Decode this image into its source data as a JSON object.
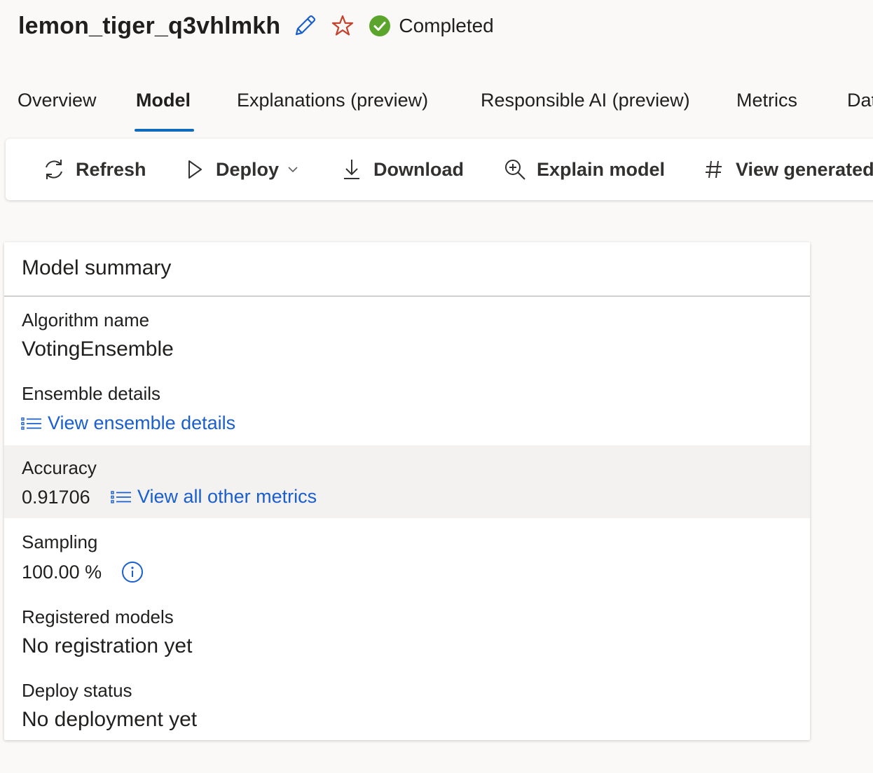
{
  "header": {
    "run_title": "lemon_tiger_q3vhlmkh",
    "status_text": "Completed",
    "icons": {
      "edit": "pencil-icon",
      "favorite": "star-outline-icon",
      "status": "check-circle-icon"
    },
    "colors": {
      "edit_icon": "#1a5fcd",
      "favorite_icon": "#c4422b",
      "status_icon": "#5ba52d"
    }
  },
  "tabs": [
    {
      "label": "Overview",
      "active": false
    },
    {
      "label": "Model",
      "active": true
    },
    {
      "label": "Explanations (preview)",
      "active": false
    },
    {
      "label": "Responsible AI (preview)",
      "active": false
    },
    {
      "label": "Metrics",
      "active": false
    },
    {
      "label": "Data transformation (preview)",
      "active": false
    }
  ],
  "toolbar": {
    "refresh_label": "Refresh",
    "deploy_label": "Deploy",
    "download_label": "Download",
    "explain_label": "Explain model",
    "view_generated_label": "View generated code",
    "icons": [
      "refresh-icon",
      "play-icon",
      "download-icon",
      "zoom-in-icon",
      "hashtag-icon"
    ]
  },
  "summary": {
    "title": "Model summary",
    "algorithm_label": "Algorithm name",
    "algorithm_value": "VotingEnsemble",
    "ensemble_label": "Ensemble details",
    "ensemble_link": "View ensemble details",
    "accuracy_label": "Accuracy",
    "accuracy_value": "0.91706",
    "metrics_link": "View all other metrics",
    "sampling_label": "Sampling",
    "sampling_value": "100.00 %",
    "registered_label": "Registered models",
    "registered_value": "No registration yet",
    "deploy_status_label": "Deploy status",
    "deploy_status_value": "No deployment yet"
  },
  "colors": {
    "accent": "#0f6cbd",
    "link": "#1a5fcd"
  }
}
